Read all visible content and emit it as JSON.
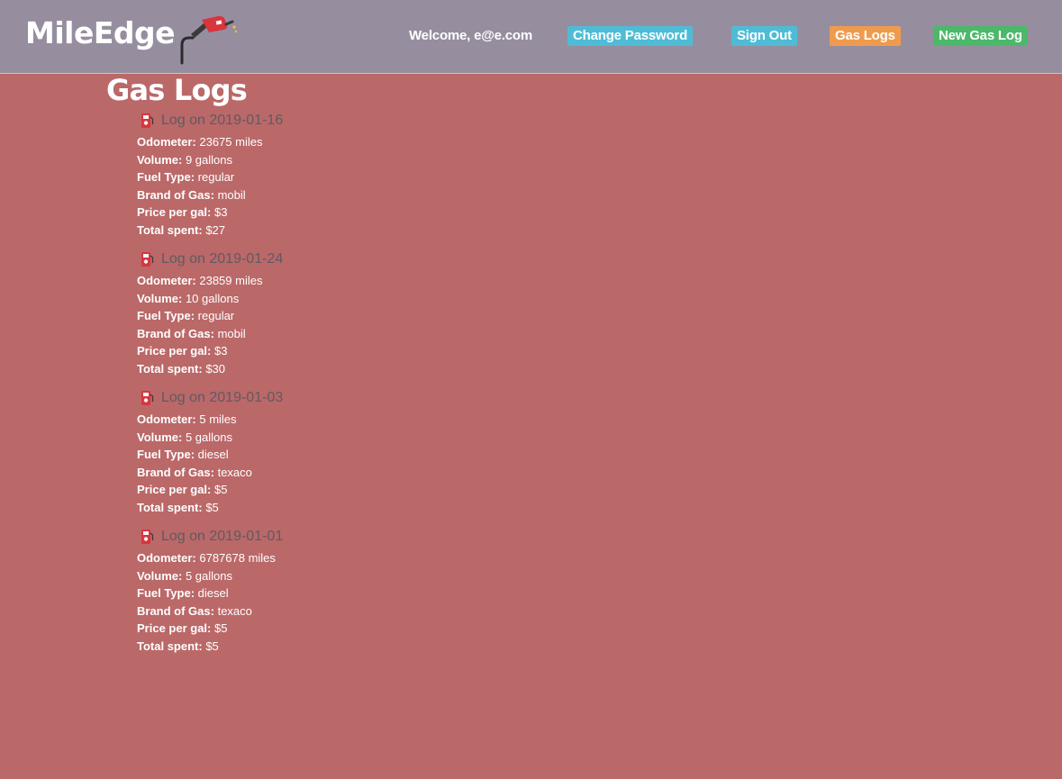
{
  "brand": "MileEdge",
  "nav": {
    "welcome": "Welcome, e@e.com",
    "change_password": "Change Password",
    "sign_out": "Sign Out",
    "gas_logs": "Gas Logs",
    "new_gas_log": "New Gas Log"
  },
  "colors": {
    "navbar": "#968e9f",
    "background": "#bb6868",
    "info_button": "#4fbcd6",
    "warning_button": "#ef9b4e",
    "success_button": "#4cb86a"
  },
  "icons": {
    "brand": "fuel-pump-nozzle-icon",
    "log": "fuel-pump-icon"
  },
  "page_title": "Gas Logs",
  "labels": {
    "odometer": "Odometer:",
    "volume": "Volume:",
    "fuel_type": "Fuel Type:",
    "brand": "Brand of Gas:",
    "price": "Price per gal:",
    "total": "Total spent:"
  },
  "logs": [
    {
      "title": "Log on 2019-01-16",
      "odometer": "23675 miles",
      "volume": "9 gallons",
      "fuel_type": "regular",
      "brand": "mobil",
      "price": "$3",
      "total": "$27"
    },
    {
      "title": "Log on 2019-01-24",
      "odometer": "23859 miles",
      "volume": "10 gallons",
      "fuel_type": "regular",
      "brand": "mobil",
      "price": "$3",
      "total": "$30"
    },
    {
      "title": "Log on 2019-01-03",
      "odometer": "5 miles",
      "volume": "5 gallons",
      "fuel_type": "diesel",
      "brand": "texaco",
      "price": "$5",
      "total": "$5"
    },
    {
      "title": "Log on 2019-01-01",
      "odometer": "6787678 miles",
      "volume": "5 gallons",
      "fuel_type": "diesel",
      "brand": "texaco",
      "price": "$5",
      "total": "$5"
    }
  ]
}
